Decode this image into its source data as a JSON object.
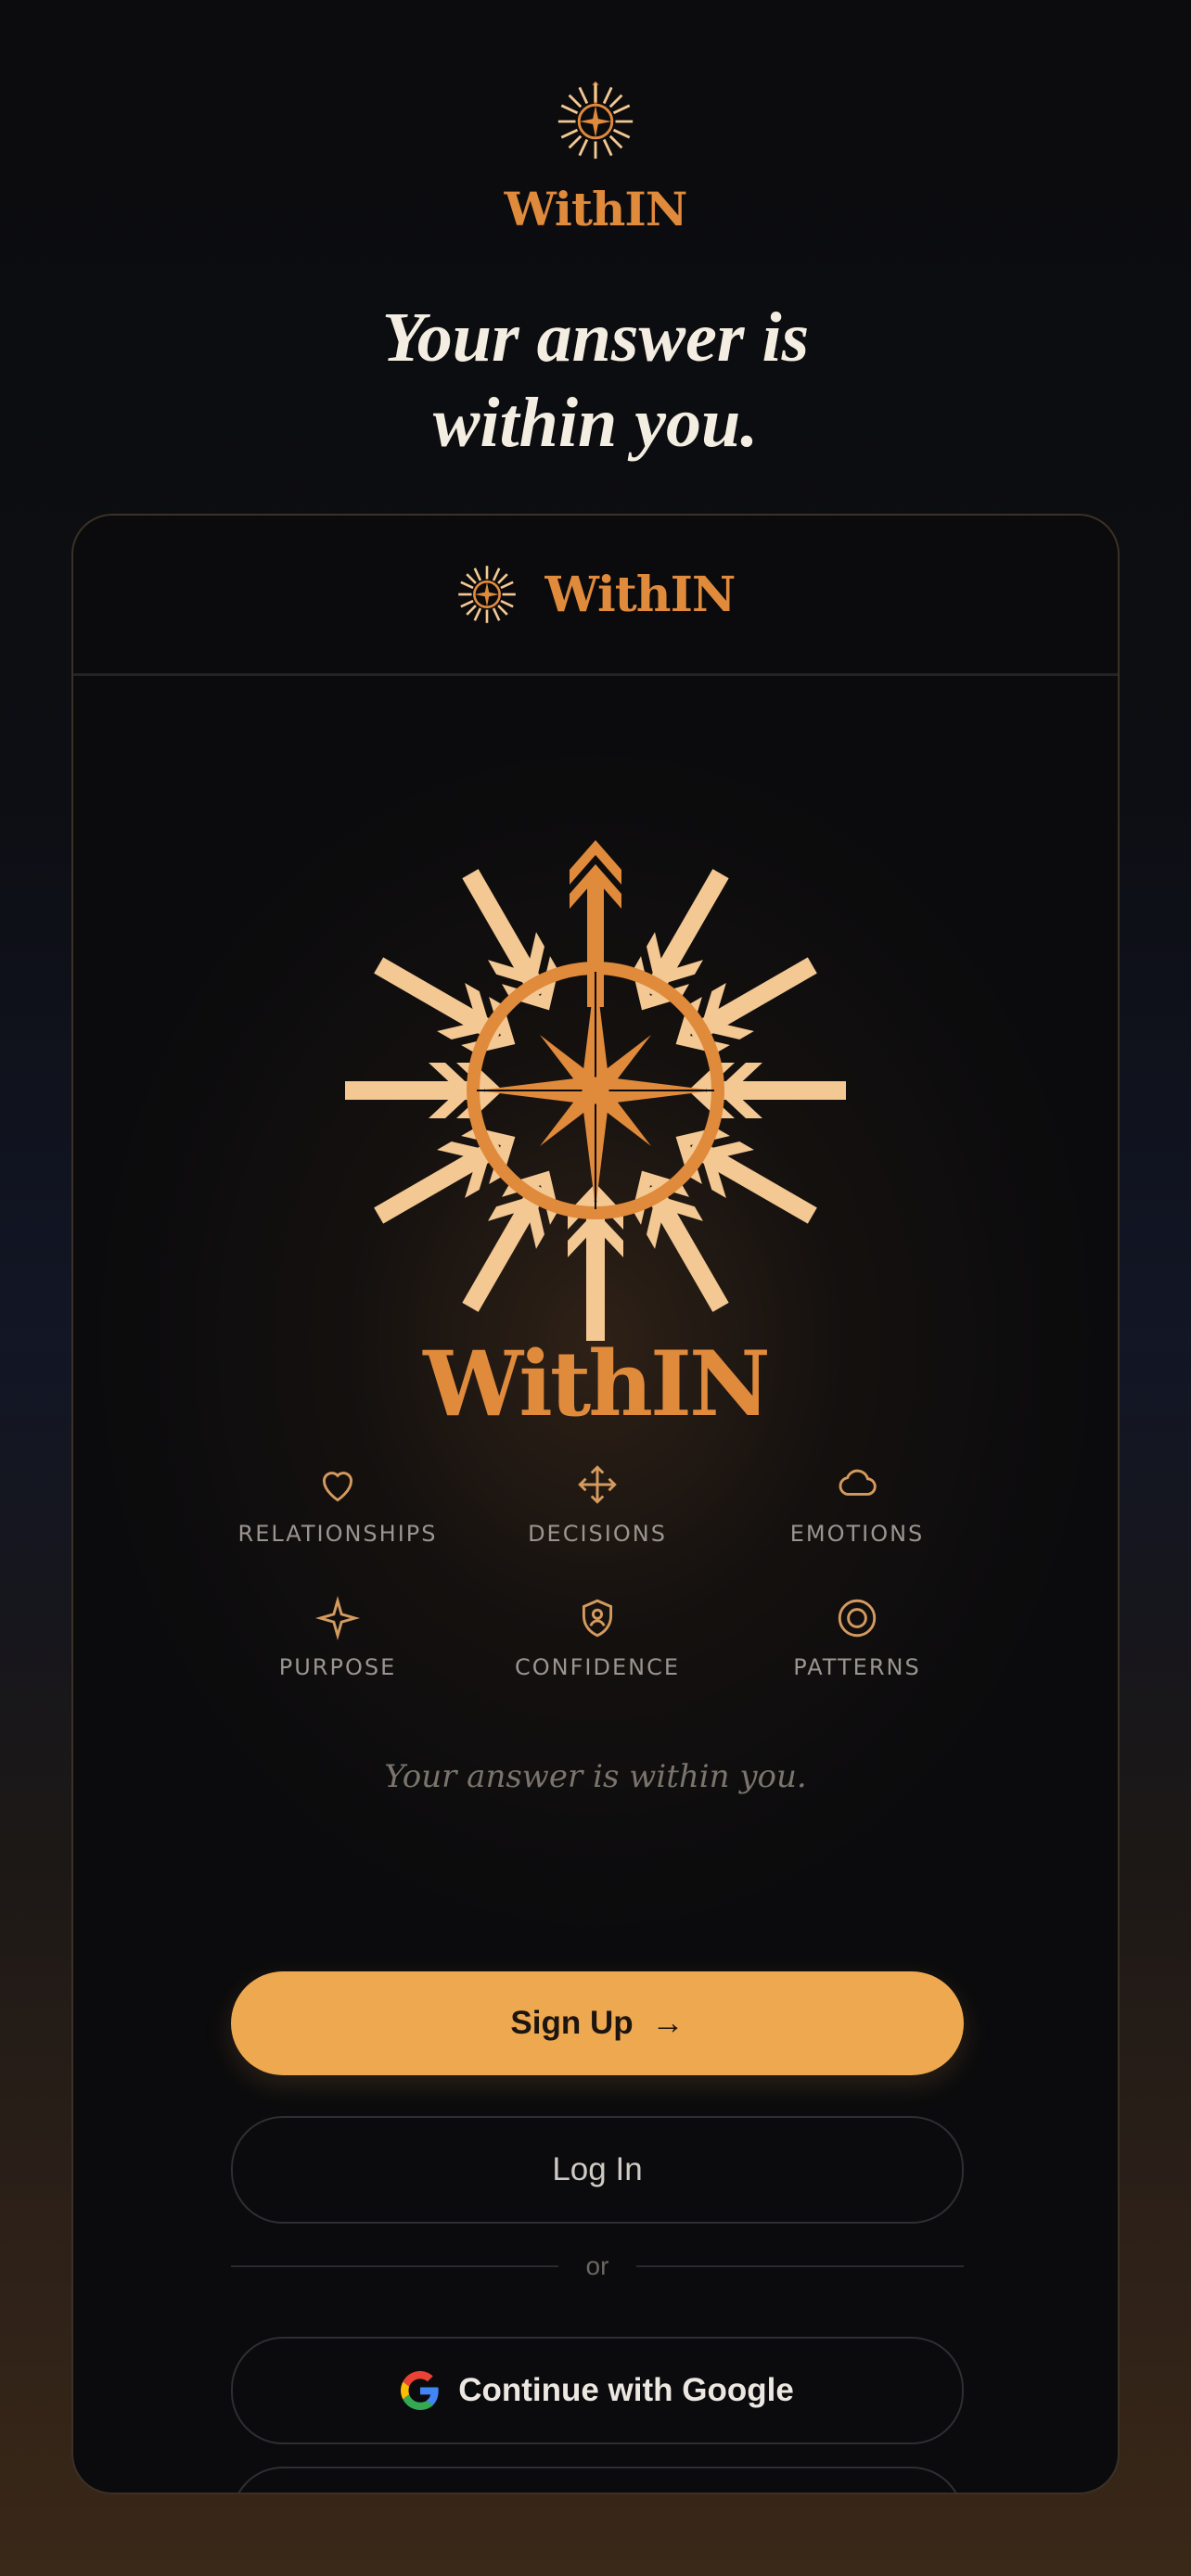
{
  "app": {
    "brand_prefix": "With",
    "brand_suffix": "IN",
    "headline_line1": "Your answer is",
    "headline_line2": "within you."
  },
  "card": {
    "header_brand_prefix": "With",
    "header_brand_suffix": "IN",
    "hero_brand_prefix": "With",
    "hero_brand_suffix": "IN",
    "features": [
      {
        "label": "RELATIONSHIPS",
        "icon": "heart-icon"
      },
      {
        "label": "DECISIONS",
        "icon": "move-arrows-icon"
      },
      {
        "label": "EMOTIONS",
        "icon": "cloud-icon"
      },
      {
        "label": "PURPOSE",
        "icon": "sparkle-icon"
      },
      {
        "label": "CONFIDENCE",
        "icon": "shield-user-icon"
      },
      {
        "label": "PATTERNS",
        "icon": "target-circle-icon"
      }
    ],
    "tagline": "Your answer is within you."
  },
  "actions": {
    "signup_label": "Sign Up",
    "signup_arrow": "→",
    "login_label": "Log In",
    "divider_text": "or",
    "google_label": "Continue with Google"
  },
  "colors": {
    "accent": "#eea84f",
    "brand_orange": "#e08a3c",
    "brand_cream": "#f3c893",
    "background": "#0b0b0d"
  }
}
